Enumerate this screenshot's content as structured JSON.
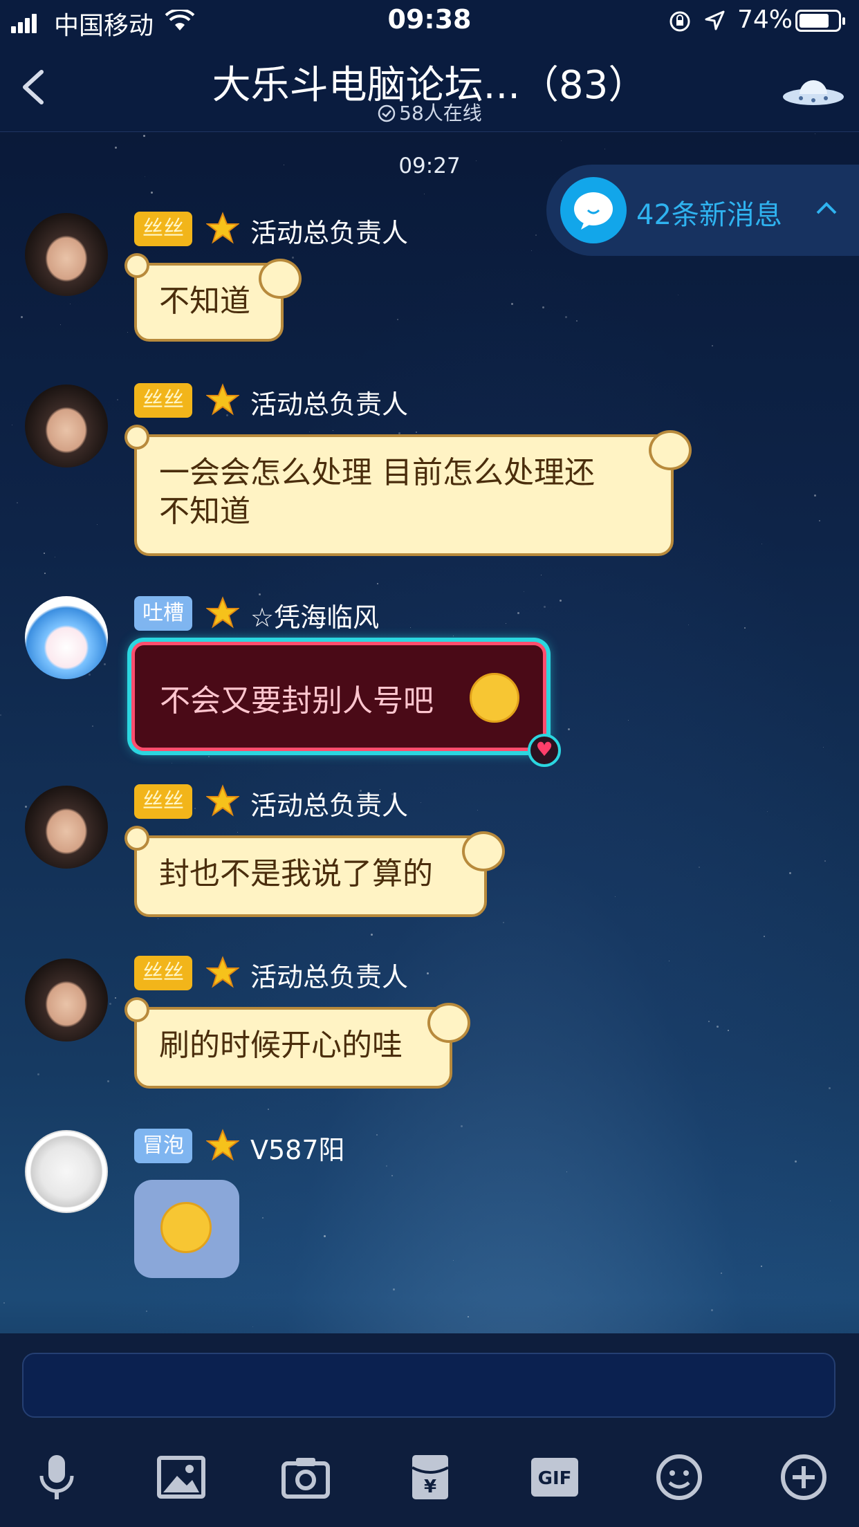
{
  "status_bar": {
    "carrier": "中国移动",
    "time": "09:38",
    "battery": "74%"
  },
  "header": {
    "title": "大乐斗电脑论坛...（83）",
    "online": "58人在线"
  },
  "timestamp": "09:27",
  "new_messages": {
    "label": "42条新消息"
  },
  "messages": [
    {
      "badge": "丝丝",
      "name": "活动总负责人",
      "text": "不知道"
    },
    {
      "badge": "丝丝",
      "name": "活动总负责人",
      "text_line1": "一会会怎么处理  目前怎么处理还",
      "text_line2": "不知道"
    },
    {
      "badge": "吐槽",
      "name": "☆凭海临风",
      "text": "不会又要封别人号吧"
    },
    {
      "badge": "丝丝",
      "name": "活动总负责人",
      "text": "封也不是我说了算的"
    },
    {
      "badge": "丝丝",
      "name": "活动总负责人",
      "text": "刷的时候开心的哇"
    },
    {
      "badge": "冒泡",
      "name": "V587阳",
      "text": ""
    }
  ],
  "toolbar": {
    "gif_label": "GIF"
  },
  "colors": {
    "header_bg": "#0a1c3f",
    "accent": "#2fb3f0",
    "bubble": "#fff3c4",
    "badge_gold": "#f2b51a",
    "badge_blue": "#7fb5f0"
  },
  "icons": [
    "microphone-icon",
    "image-icon",
    "camera-icon",
    "red-packet-icon",
    "gif-icon",
    "emoji-icon",
    "plus-icon"
  ]
}
